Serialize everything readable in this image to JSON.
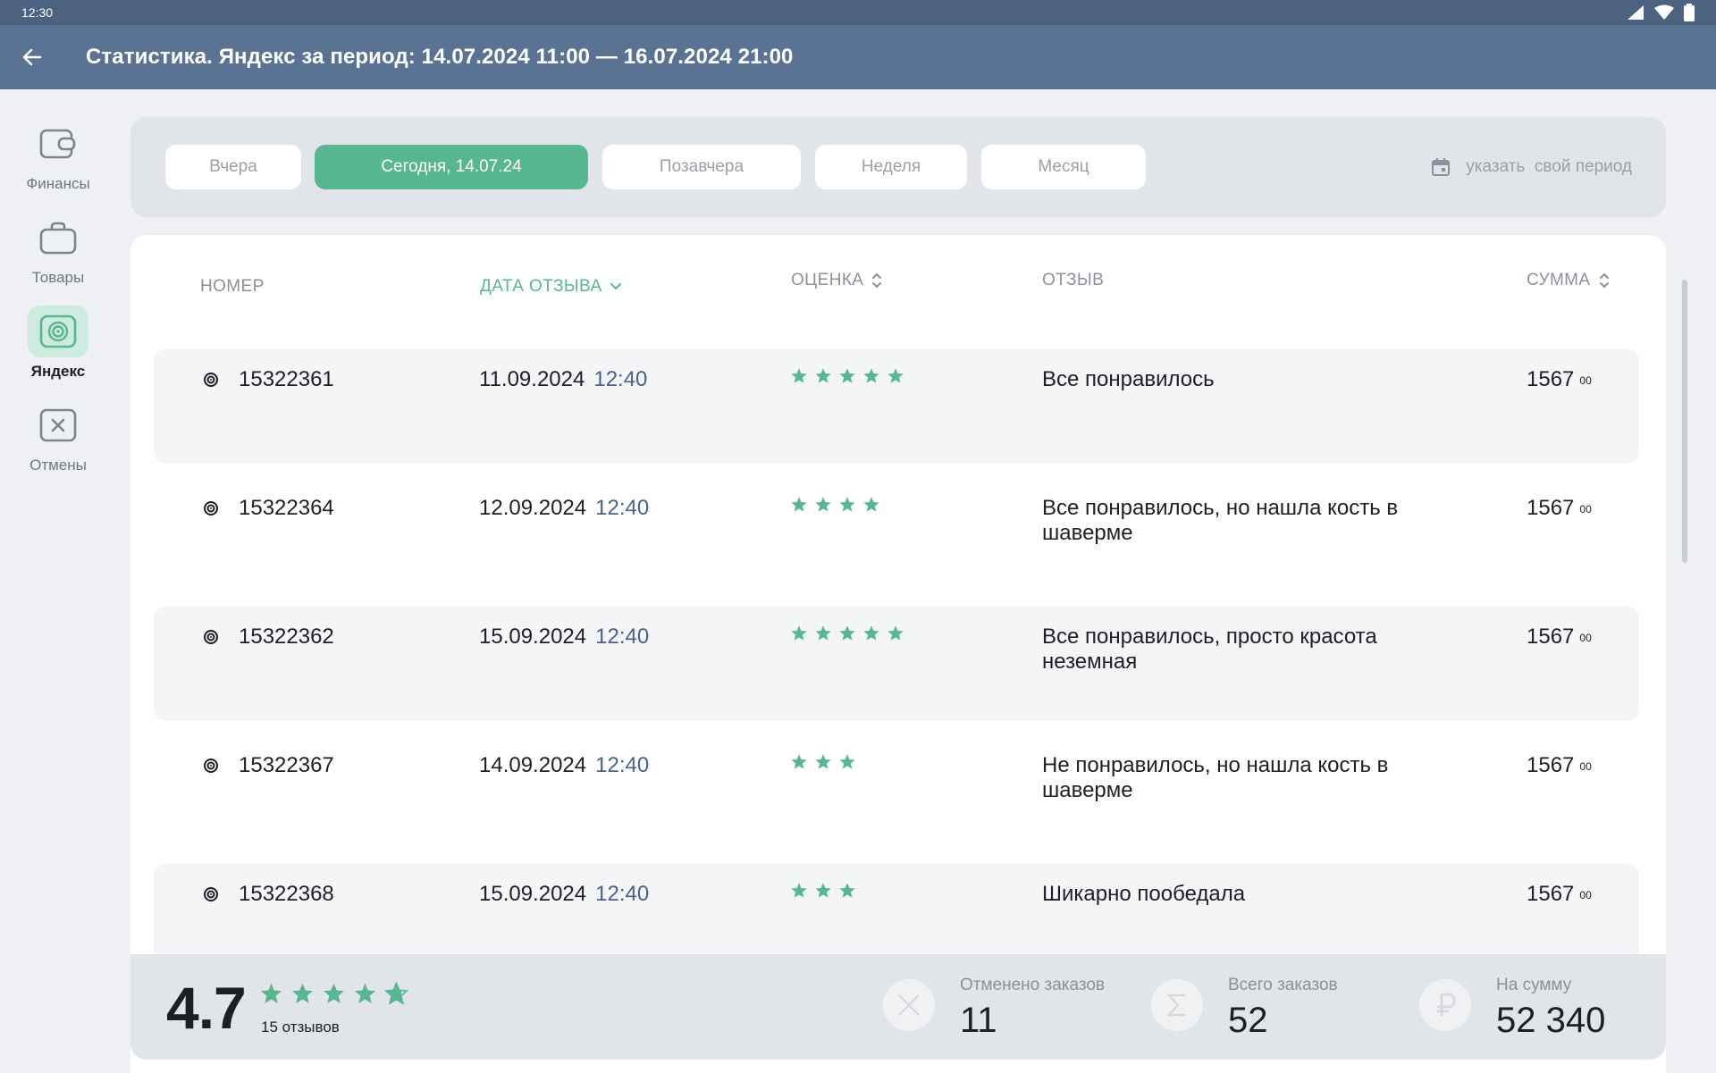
{
  "status_bar": {
    "time": "12:30"
  },
  "app_bar": {
    "title": "Статистика. Яндекс за период: 14.07.2024 11:00 — 16.07.2024 21:00"
  },
  "sidebar": {
    "items": [
      {
        "label": "Финансы",
        "icon": "wallet-icon",
        "active": false
      },
      {
        "label": "Товары",
        "icon": "bag-icon",
        "active": false
      },
      {
        "label": "Яндекс",
        "icon": "yandex-spiral-icon",
        "active": true
      },
      {
        "label": "Отмены",
        "icon": "cancel-box-icon",
        "active": false
      }
    ]
  },
  "filters": {
    "chips": [
      {
        "label": "Вчера",
        "active": false
      },
      {
        "label": "Сегодня, 14.07.24",
        "active": true
      },
      {
        "label": "Позавчера",
        "active": false
      },
      {
        "label": "Неделя",
        "active": false
      },
      {
        "label": "Месяц",
        "active": false
      }
    ],
    "custom_period": "указать  свой период"
  },
  "table": {
    "columns": {
      "number": "НОМЕР",
      "date": "ДАТА ОТЗЫВА",
      "rating": "ОЦЕНКА",
      "review": "ОТЗЫВ",
      "sum": "СУММА"
    },
    "rows": [
      {
        "number": "15322361",
        "date": "11.09.2024",
        "time": "12:40",
        "rating": 5,
        "review": "Все понравилось",
        "sum": "1567",
        "kop": "00"
      },
      {
        "number": "15322364",
        "date": "12.09.2024",
        "time": "12:40",
        "rating": 4,
        "review": "Все понравилось, но нашла кость в шаверме",
        "sum": "1567",
        "kop": "00"
      },
      {
        "number": "15322362",
        "date": "15.09.2024",
        "time": "12:40",
        "rating": 5,
        "review": "Все понравилось, просто красота неземная",
        "sum": "1567",
        "kop": "00"
      },
      {
        "number": "15322367",
        "date": "14.09.2024",
        "time": "12:40",
        "rating": 3,
        "review": "Не понравилось, но нашла кость в шаверме",
        "sum": "1567",
        "kop": "00"
      },
      {
        "number": "15322368",
        "date": "15.09.2024",
        "time": "12:40",
        "rating": 3,
        "review": "Шикарно пообедала",
        "sum": "1567",
        "kop": "00"
      }
    ]
  },
  "summary": {
    "rating": "4.7",
    "rating_value": 4.7,
    "reviews": "15 отзывов",
    "canceled": {
      "label": "Отменено заказов",
      "value": "11",
      "icon": "close-icon"
    },
    "total": {
      "label": "Всего заказов",
      "value": "52",
      "icon": "sigma-icon"
    },
    "amount": {
      "label": "На сумму",
      "value": "52 340",
      "icon": "ruble-icon"
    }
  },
  "colors": {
    "accent": "#58b690",
    "app_bar": "#5b7393",
    "status_bar": "#4c6281",
    "time_text": "#4a6285"
  }
}
